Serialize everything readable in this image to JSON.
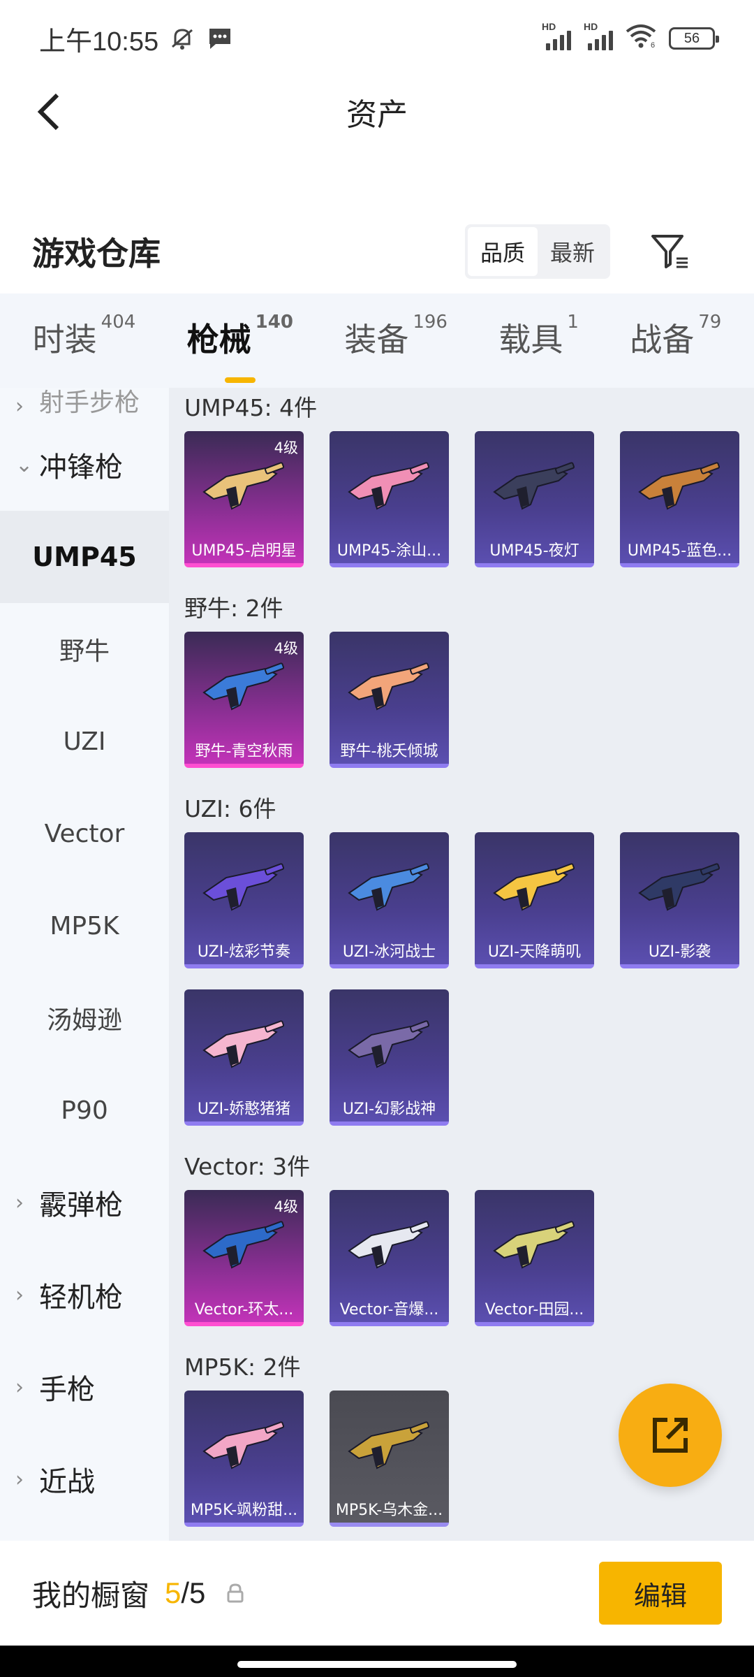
{
  "status": {
    "time": "上午10:55",
    "hd1": "HD",
    "hd2": "HD",
    "wifi_num": "6",
    "battery": "56"
  },
  "header": {
    "title": "资产"
  },
  "section": {
    "title": "游戏仓库",
    "sort_quality": "品质",
    "sort_latest": "最新"
  },
  "tabs": [
    {
      "label": "时装",
      "count": "404"
    },
    {
      "label": "枪械",
      "count": "140"
    },
    {
      "label": "装备",
      "count": "196"
    },
    {
      "label": "载具",
      "count": "1"
    },
    {
      "label": "战备",
      "count": "79"
    }
  ],
  "sidebar": {
    "partial": "射手步枪",
    "group_smg": "冲锋枪",
    "items": [
      "UMP45",
      "野牛",
      "UZI",
      "Vector",
      "MP5K",
      "汤姆逊",
      "P90"
    ],
    "groups": [
      "霰弹枪",
      "轻机枪",
      "手枪",
      "近战"
    ]
  },
  "groups": [
    {
      "title": "UMP45: 4件",
      "cards": [
        {
          "name": "UMP45-启明星",
          "level": "4级",
          "rarity": "gold",
          "color": "#e9c27a"
        },
        {
          "name": "UMP45-涂山...",
          "level": "",
          "rarity": "purple",
          "color": "#f08fb5"
        },
        {
          "name": "UMP45-夜灯",
          "level": "",
          "rarity": "purple",
          "color": "#3b3f5c"
        },
        {
          "name": "UMP45-蓝色...",
          "level": "",
          "rarity": "purple",
          "color": "#c9813a"
        }
      ]
    },
    {
      "title": "野牛: 2件",
      "cards": [
        {
          "name": "野牛-青空秋雨",
          "level": "4级",
          "rarity": "gold",
          "color": "#3b7bd9"
        },
        {
          "name": "野牛-桃夭倾城",
          "level": "",
          "rarity": "purple",
          "color": "#f2a57a"
        }
      ]
    },
    {
      "title": "UZI: 6件",
      "cards": [
        {
          "name": "UZI-炫彩节奏",
          "level": "",
          "rarity": "purple",
          "color": "#6b4fd9"
        },
        {
          "name": "UZI-冰河战士",
          "level": "",
          "rarity": "purple",
          "color": "#4b8be0"
        },
        {
          "name": "UZI-天降萌叽",
          "level": "",
          "rarity": "purple",
          "color": "#f5c542"
        },
        {
          "name": "UZI-影袭",
          "level": "",
          "rarity": "purple",
          "color": "#2f3a66"
        },
        {
          "name": "UZI-娇憨猪猪",
          "level": "",
          "rarity": "purple",
          "color": "#f5b5cf"
        },
        {
          "name": "UZI-幻影战神",
          "level": "",
          "rarity": "purple",
          "color": "#7a6aa8"
        }
      ]
    },
    {
      "title": "Vector: 3件",
      "cards": [
        {
          "name": "Vector-环太...",
          "level": "4级",
          "rarity": "gold",
          "color": "#2d6ac9"
        },
        {
          "name": "Vector-音爆...",
          "level": "",
          "rarity": "purple",
          "color": "#e6e8f0"
        },
        {
          "name": "Vector-田园...",
          "level": "",
          "rarity": "purple",
          "color": "#d8d27a"
        }
      ]
    },
    {
      "title": "MP5K: 2件",
      "cards": [
        {
          "name": "MP5K-飒粉甜...",
          "level": "",
          "rarity": "purple",
          "color": "#f2a6c6"
        },
        {
          "name": "MP5K-乌木金...",
          "level": "",
          "rarity": "gray",
          "color": "#c9a23a"
        }
      ]
    }
  ],
  "bottom": {
    "label": "我的橱窗",
    "count_a": "5",
    "count_sep": "/",
    "count_b": "5",
    "edit": "编辑"
  }
}
